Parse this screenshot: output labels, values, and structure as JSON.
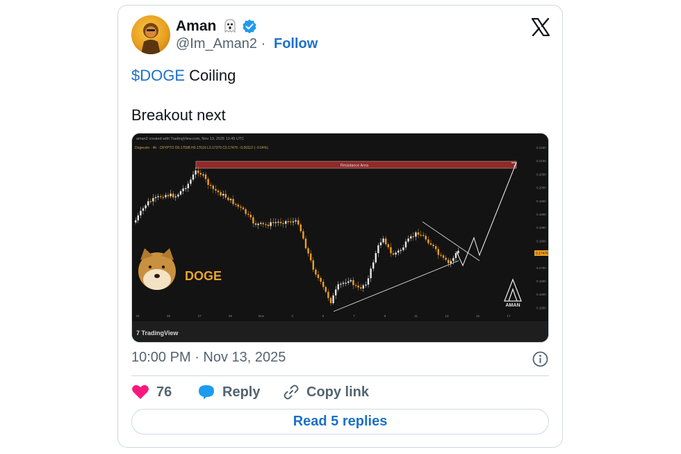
{
  "author": {
    "name": "Aman",
    "handle": "@Im_Aman2",
    "separator": " · ",
    "follow_label": "Follow"
  },
  "tweet": {
    "cashtag": "$DOGE",
    "line1_rest": " Coiling",
    "line2": "Breakout next"
  },
  "chart_image": {
    "header": "aman2 created with TradingView.com, Nov 13, 2025 13:45 UTC",
    "symbol_line": "Dogecoin · 4h · CRYPTO   O0.17598  H0.17616  L0.17370  C0.17476  −0.00112 (−0.64%)",
    "resistance_label": "Resistance Area",
    "doge_label": "DOGE",
    "watermark": "AMAN",
    "brand": "TradingView",
    "x_ticks": [
      "23",
      "25",
      "27",
      "29",
      "Nov",
      "3",
      "5",
      "7",
      "9",
      "11",
      "13",
      "15",
      "17"
    ],
    "y_ticks": [
      "0.2150",
      "0.2100",
      "0.2050",
      "0.2000",
      "0.1950",
      "0.1900",
      "0.1850",
      "0.1800",
      "0.1750",
      "0.1700",
      "0.1650",
      "0.1600",
      "0.1550"
    ],
    "price_tag": "0.17476",
    "colors": {
      "up": "#e6e6e6",
      "down": "#f0a020",
      "resistance": "#8e2a2a"
    }
  },
  "meta": {
    "timestamp": "10:00 PM · Nov 13, 2025"
  },
  "actions": {
    "likes": "76",
    "reply_label": "Reply",
    "copy_label": "Copy link",
    "read_replies_label": "Read 5 replies"
  },
  "colors": {
    "link": "#1d70c8",
    "like": "#f91880",
    "reply": "#1d9bf0"
  }
}
